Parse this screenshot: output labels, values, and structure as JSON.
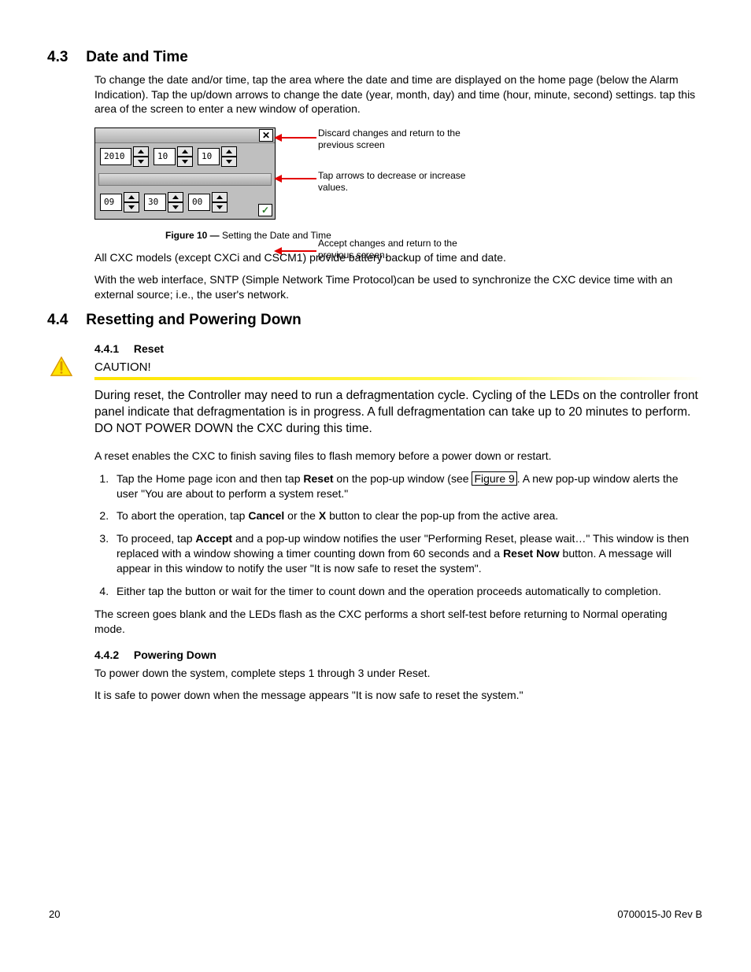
{
  "section43": {
    "num": "4.3",
    "title": "Date and Time",
    "para1": "To change the date and/or time, tap the area where the date and time are displayed on the home page (below the Alarm Indication). Tap the up/down arrows to change the date (year, month, day) and time (hour, minute, second) settings. tap this area of the screen to enter a new window of operation."
  },
  "datetime_ui": {
    "year": "2010",
    "month": "10",
    "day": "10",
    "hour": "09",
    "minute": "30",
    "second": "00",
    "callout_discard": "Discard changes and return to the previous screen",
    "callout_arrows": "Tap arrows to decrease or increase values.",
    "callout_accept": "Accept changes and return to the previous screen."
  },
  "figure10": {
    "label": "Figure 10  —",
    "text": "  Setting the Date and Time"
  },
  "section43_after": {
    "para2": "All CXC models (except CXCi and CSCM1) provide battery backup of time and date.",
    "para3": "With the web interface, SNTP (Simple Network Time Protocol)can be used to synchronize the CXC device time with an external source; i.e., the user's network."
  },
  "section44": {
    "num": "4.4",
    "title": "Resetting and Powering Down"
  },
  "section441": {
    "num": "4.4.1",
    "title": "Reset",
    "caution_label": "CAUTION!",
    "caution_text": "During reset, the Controller may need to run a defragmentation cycle. Cycling of the LEDs on the controller front panel indicate that defragmentation is in progress. A full defragmentation can take up to 20 minutes to perform. DO NOT POWER DOWN the CXC during this time.",
    "intro": "A reset enables the CXC to finish saving files to flash memory before a power down or restart.",
    "step1_a": "Tap the  Home page icon and then tap ",
    "step1_bold1": "Reset",
    "step1_b": " on the pop-up window (see ",
    "step1_link": "Figure 9",
    "step1_c": ". A new pop-up window alerts the user \"You are about to perform a system reset.\"",
    "step2_a": "To abort the operation, tap ",
    "step2_bold1": "Cancel",
    "step2_b": " or the ",
    "step2_bold2": "X",
    "step2_c": " button to clear the pop-up from the active area.",
    "step3_a": "To proceed, tap ",
    "step3_bold1": "Accept",
    "step3_b": " and a pop-up window notifies the user \"Performing Reset, please wait…\" This window is then replaced with a window showing a timer counting down from 60 seconds and a ",
    "step3_bold2": "Reset Now",
    "step3_c": " button. A message will appear in this window to notify the user \"It is now safe to reset the system\".",
    "step4": "Either tap the button or wait for the timer to count down and the operation proceeds automatically to completion.",
    "outro": "The screen goes blank and the LEDs flash as the CXC performs a short self-test before returning to Normal operating mode."
  },
  "section442": {
    "num": "4.4.2",
    "title": "Powering Down",
    "p1": "To power down the system, complete steps 1 through 3 under Reset.",
    "p2": "It is safe to power down when the message appears  \"It is now safe to reset the system.\""
  },
  "footer": {
    "page": "20",
    "doc": "0700015-J0    Rev B"
  }
}
